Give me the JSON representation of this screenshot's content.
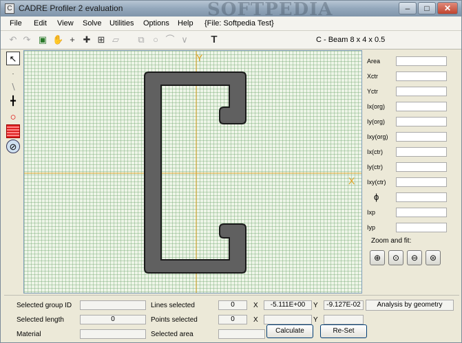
{
  "window": {
    "title": "CADRE Profiler 2 evaluation",
    "watermark": "SOFTPEDIA"
  },
  "menu": {
    "items": [
      "File",
      "Edit",
      "View",
      "Solve",
      "Utilities",
      "Options",
      "Help"
    ],
    "file_info": "{File: Softpedia Test}"
  },
  "toolbar": {
    "shape_name": "C - Beam 8 x 4 x 0.5",
    "icons": [
      "undo-icon",
      "redo-icon",
      "image-icon",
      "pan-hand-icon",
      "crosshair-icon",
      "snap-icon",
      "grid-icon",
      "skew-icon",
      "copy-icon",
      "circle-icon",
      "arc-icon",
      "polyline-icon",
      "text-icon"
    ]
  },
  "left_tools": [
    "pointer-icon",
    "point-icon",
    "line-icon",
    "node-icon",
    "circle-outline-icon",
    "hatch-fill-icon",
    "hole-icon"
  ],
  "canvas": {
    "axis_x_label": "X",
    "axis_y_label": "Y",
    "colors": {
      "shape": "#606060",
      "axis": "#e0a020",
      "grid": "#9cc49c"
    }
  },
  "properties": {
    "labels": [
      "Area",
      "Xctr",
      "Yctr",
      "Ix(org)",
      "Iy(org)",
      "Ixy(org)",
      "Ix(ctr)",
      "Iy(ctr)",
      "Ixy(ctr)",
      "ϕ",
      "Ixp",
      "Iyp"
    ],
    "zoom_label": "Zoom and fit:",
    "zoom_icons": [
      "zoom-in-icon",
      "zoom-window-icon",
      "zoom-out-icon",
      "zoom-fit-icon"
    ]
  },
  "status": {
    "selected_group_id_label": "Selected group ID",
    "selected_group_id_value": "",
    "selected_length_label": "Selected length",
    "selected_length_value": "0",
    "material_label": "Material",
    "material_value": "",
    "lines_selected_label": "Lines selected",
    "lines_selected_value": "0",
    "points_selected_label": "Points selected",
    "points_selected_value": "0",
    "selected_area_label": "Selected area",
    "selected_area_value": "",
    "x_label": "X",
    "x_value": "-5.111E+00",
    "y_label": "Y",
    "y_value": "-9.127E-02",
    "x2_value": "",
    "y2_value": "",
    "analysis": "Analysis by geometry",
    "calculate_label": "Calculate",
    "reset_label": "Re-Set"
  }
}
